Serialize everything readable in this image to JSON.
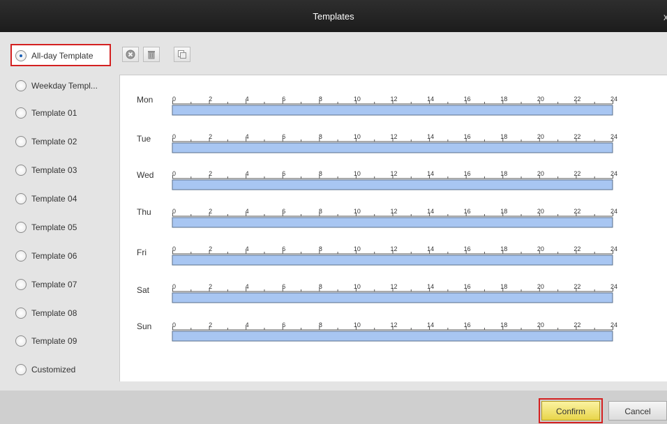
{
  "window": {
    "title": "Templates",
    "close_glyph": "x"
  },
  "template_options": [
    {
      "label": "All-day Template",
      "selected": true
    },
    {
      "label": "Weekday Templ...",
      "selected": false
    },
    {
      "label": "Template 01",
      "selected": false
    },
    {
      "label": "Template 02",
      "selected": false
    },
    {
      "label": "Template 03",
      "selected": false
    },
    {
      "label": "Template 04",
      "selected": false
    },
    {
      "label": "Template 05",
      "selected": false
    },
    {
      "label": "Template 06",
      "selected": false
    },
    {
      "label": "Template 07",
      "selected": false
    },
    {
      "label": "Template 08",
      "selected": false
    },
    {
      "label": "Template 09",
      "selected": false
    },
    {
      "label": "Customized",
      "selected": false
    }
  ],
  "toolbar": {
    "icons": [
      "delete-icon",
      "trash-icon",
      "copy-icon"
    ]
  },
  "schedule": {
    "days": [
      "Mon",
      "Tue",
      "Wed",
      "Thu",
      "Fri",
      "Sat",
      "Sun"
    ],
    "hour_ticks": [
      "0",
      "2",
      "4",
      "6",
      "8",
      "10",
      "12",
      "14",
      "16",
      "18",
      "20",
      "22",
      "24"
    ],
    "scheduled_start_hour": 0,
    "scheduled_end_hour": 24,
    "bar_color": "#a8c6f2"
  },
  "footer": {
    "confirm_label": "Confirm",
    "cancel_label": "Cancel"
  },
  "colors": {
    "highlight": "#d42020",
    "titlebar": "#222222"
  }
}
